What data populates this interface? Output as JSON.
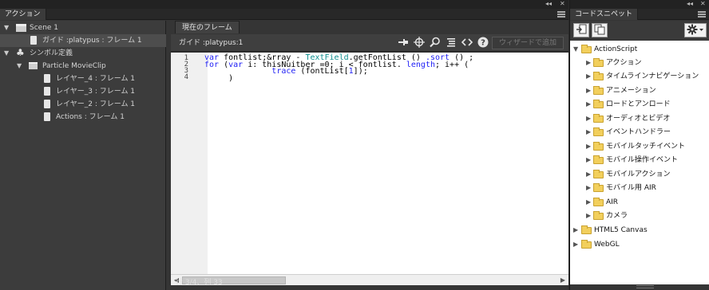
{
  "window": {
    "collapse_glyph": "◂◂",
    "close_glyph": "✕"
  },
  "actions_panel": {
    "tab_label": "アクション",
    "tree": [
      {
        "label": "Scene 1",
        "icon": "clapperboard-icon",
        "expand": "▼"
      },
      {
        "label": "ガイド :platypus : フレーム 1",
        "icon": "document-icon"
      },
      {
        "label": "シンボル定義",
        "icon": "club-icon",
        "expand": "▼"
      },
      {
        "label": "Particle MovieClip",
        "icon": "clapperboard-icon",
        "expand": "▼"
      },
      {
        "label": "レイヤー_4 : フレーム 1",
        "icon": "document-icon"
      },
      {
        "label": "レイヤー_3 : フレーム 1",
        "icon": "document-icon"
      },
      {
        "label": "レイヤー_2 : フレーム 1",
        "icon": "document-icon"
      },
      {
        "label": "Actions : フレーム 1",
        "icon": "document-icon"
      }
    ],
    "editor": {
      "frame_tab": "現在のフレーム",
      "target_label": "ガイド :platypus:1",
      "wizard_button": "ウィザードで追加",
      "line_numbers": [
        "1",
        "2",
        "3",
        "4"
      ],
      "status": "行 3/4、列 33"
    }
  },
  "snippets_panel": {
    "tab_label": "コードスニペット",
    "tree": [
      {
        "label": "ActionScript",
        "expand": "▼",
        "level": 0
      },
      {
        "label": "アクション",
        "expand": "▶",
        "level": 1
      },
      {
        "label": "タイムラインナビゲーション",
        "expand": "▶",
        "level": 1
      },
      {
        "label": "アニメーション",
        "expand": "▶",
        "level": 1
      },
      {
        "label": "ロードとアンロード",
        "expand": "▶",
        "level": 1
      },
      {
        "label": "オーディオとビデオ",
        "expand": "▶",
        "level": 1
      },
      {
        "label": "イベントハンドラー",
        "expand": "▶",
        "level": 1
      },
      {
        "label": "モバイルタッチイベント",
        "expand": "▶",
        "level": 1
      },
      {
        "label": "モバイル操作イベント",
        "expand": "▶",
        "level": 1
      },
      {
        "label": "モバイルアクション",
        "expand": "▶",
        "level": 1
      },
      {
        "label": "モバイル用 AIR",
        "expand": "▶",
        "level": 1
      },
      {
        "label": "AIR",
        "expand": "▶",
        "level": 1
      },
      {
        "label": "カメラ",
        "expand": "▶",
        "level": 1
      },
      {
        "label": "HTML5 Canvas",
        "expand": "▶",
        "level": 0
      },
      {
        "label": "WebGL",
        "expand": "▶",
        "level": 0
      }
    ]
  },
  "colors": {
    "keyword": "#1f1ff5",
    "class_name": "#0f8f8f",
    "folder": "#f2cf5c"
  }
}
